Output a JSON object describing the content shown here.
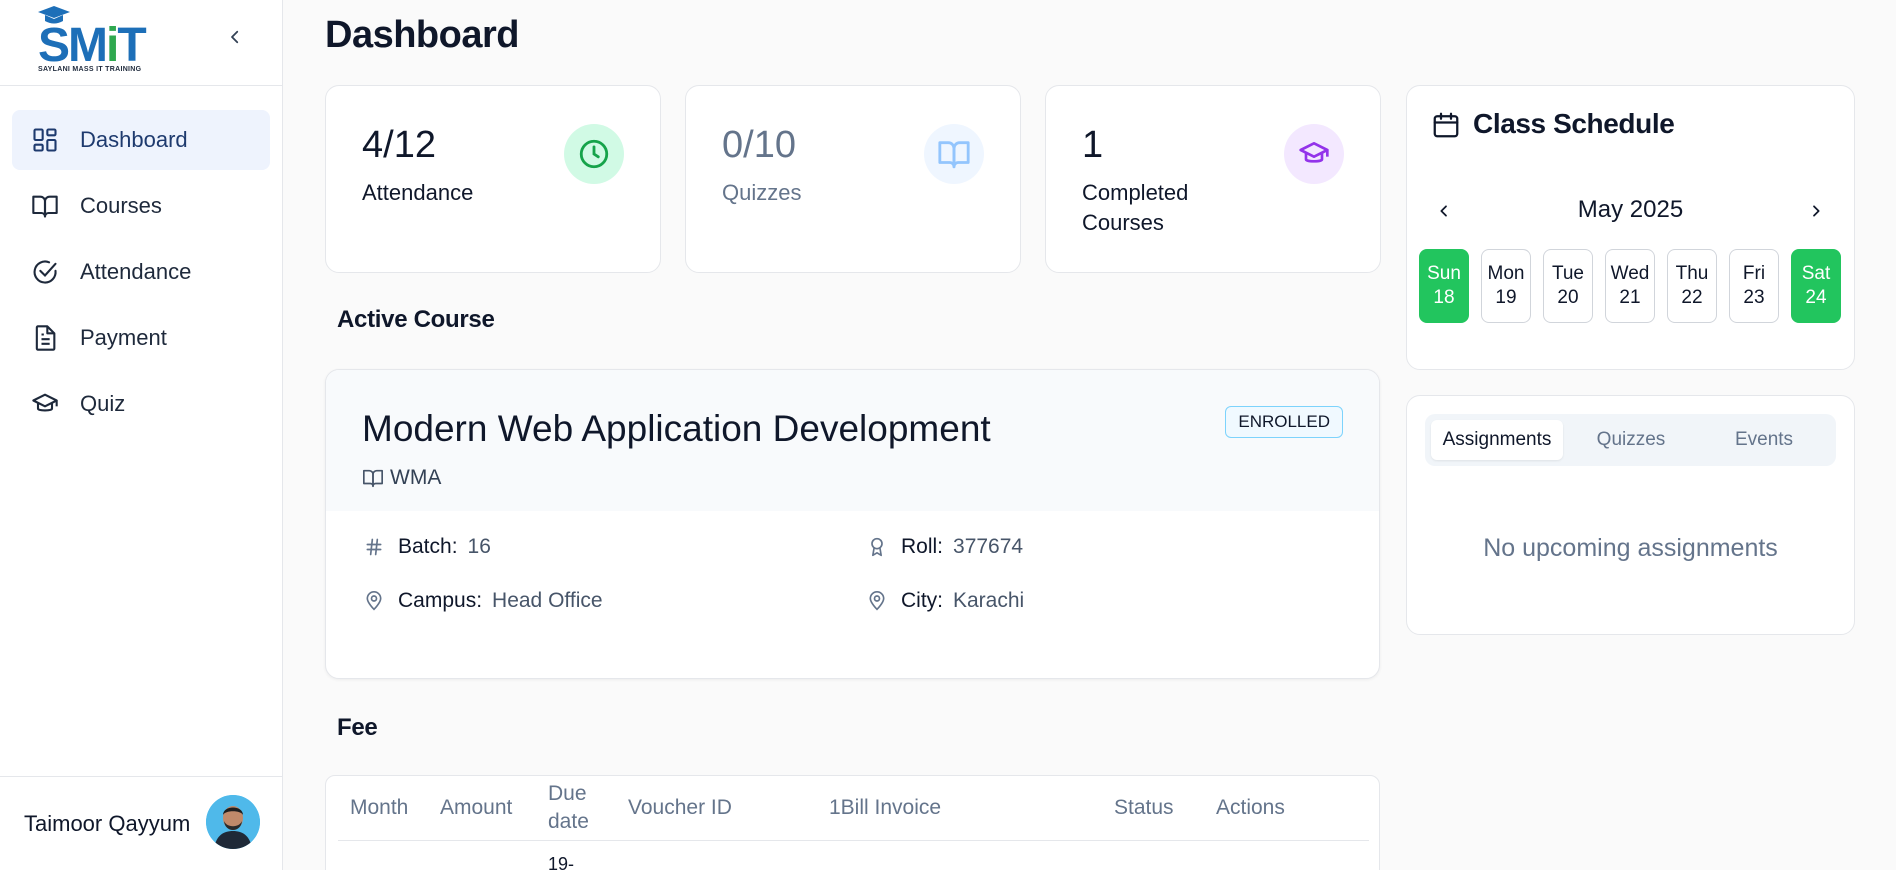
{
  "brand": {
    "logo_text_a": "SM",
    "logo_text_b": "i",
    "logo_text_c": "T",
    "logo_subtitle": "SAYLANI MASS IT TRAINING"
  },
  "sidebar": {
    "items": [
      {
        "label": "Dashboard",
        "icon": "dashboard-icon",
        "active": true
      },
      {
        "label": "Courses",
        "icon": "book-icon"
      },
      {
        "label": "Attendance",
        "icon": "check-circle-icon"
      },
      {
        "label": "Payment",
        "icon": "document-icon"
      },
      {
        "label": "Quiz",
        "icon": "graduation-cap-icon"
      }
    ],
    "user_name": "Taimoor Qayyum"
  },
  "page": {
    "title": "Dashboard"
  },
  "stats": [
    {
      "value": "4/12",
      "label": "Attendance",
      "icon": "clock-icon",
      "color": "#16a34a"
    },
    {
      "value": "0/10",
      "label": "Quizzes",
      "icon": "book-open-icon",
      "color": "#93c5fd"
    },
    {
      "value": "1",
      "label": "Completed Courses",
      "icon": "graduation-cap-icon",
      "color": "#9333ea"
    }
  ],
  "active_course": {
    "section_title": "Active Course",
    "title": "Modern Web Application Development",
    "code": "WMA",
    "badge": "ENROLLED",
    "batch_label": "Batch:",
    "batch": "16",
    "roll_label": "Roll:",
    "roll": "377674",
    "campus_label": "Campus:",
    "campus": "Head Office",
    "city_label": "City:",
    "city": "Karachi"
  },
  "fee": {
    "section_title": "Fee",
    "columns": [
      "Month",
      "Amount",
      "Due date",
      "Voucher ID",
      "1Bill Invoice",
      "Status",
      "Actions"
    ],
    "first_row_due": "19-"
  },
  "schedule": {
    "title": "Class Schedule",
    "month": "May 2025",
    "days": [
      {
        "name": "Sun",
        "date": "18",
        "active": true
      },
      {
        "name": "Mon",
        "date": "19"
      },
      {
        "name": "Tue",
        "date": "20"
      },
      {
        "name": "Wed",
        "date": "21"
      },
      {
        "name": "Thu",
        "date": "22"
      },
      {
        "name": "Fri",
        "date": "23"
      },
      {
        "name": "Sat",
        "date": "24",
        "active": true
      }
    ],
    "accent": "#22c55e"
  },
  "upcoming": {
    "tabs": [
      "Assignments",
      "Quizzes",
      "Events"
    ],
    "active_tab": "Assignments",
    "empty_text": "No upcoming assignments"
  }
}
